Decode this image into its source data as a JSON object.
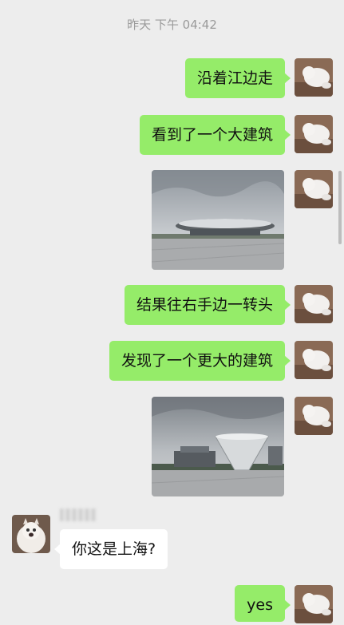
{
  "chat": {
    "timestamp": "昨天 下午 04:42",
    "messages": [
      {
        "from": "me",
        "type": "text",
        "text": "沿着江边走"
      },
      {
        "from": "me",
        "type": "text",
        "text": "看到了一个大建筑"
      },
      {
        "from": "me",
        "type": "image",
        "alt": "flying-saucer-building-photo"
      },
      {
        "from": "me",
        "type": "text",
        "text": "结果往右手边一转头"
      },
      {
        "from": "me",
        "type": "text",
        "text": "发现了一个更大的建筑"
      },
      {
        "from": "me",
        "type": "image",
        "alt": "inverted-cone-building-photo"
      },
      {
        "from": "other",
        "type": "text",
        "text": "你这是上海?"
      },
      {
        "from": "me",
        "type": "text",
        "text": "yes"
      }
    ]
  },
  "colors": {
    "background": "#ededed",
    "my_bubble": "#95ec69",
    "their_bubble": "#ffffff",
    "timestamp_text": "#9a9a9a"
  }
}
